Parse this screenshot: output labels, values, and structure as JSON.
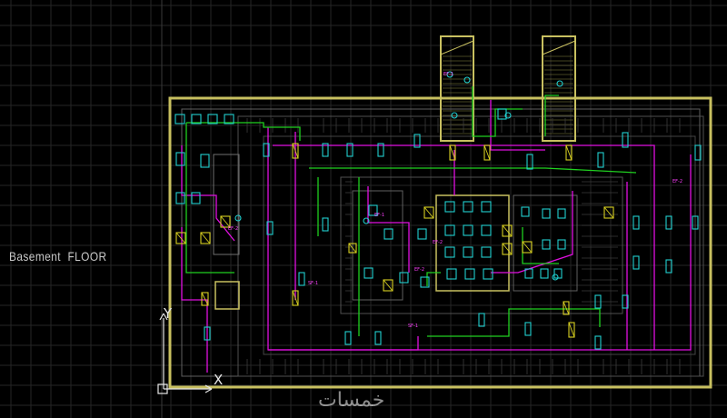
{
  "drawing": {
    "floor_label": "Basement  FLOOR",
    "ucs": {
      "y_label": "Y",
      "x_label": "X"
    },
    "watermark": "خمسات"
  },
  "colors": {
    "background": "#000000",
    "grid": "#2a2a2a",
    "wall": "#c8c060",
    "wall_inner": "#606060",
    "duct_magenta": "#e010e0",
    "pipe_green": "#20d020",
    "fan_cyan": "#20d0d0",
    "damper_yellow": "#d8d020",
    "label_magenta": "#ff40ff"
  },
  "tags": {
    "fan_tag": "EF-1",
    "supply_tag": "SF-1",
    "zone_tag": "EF-2"
  },
  "icons": [
    "ucs-icon",
    "fan-symbol",
    "damper-symbol"
  ]
}
